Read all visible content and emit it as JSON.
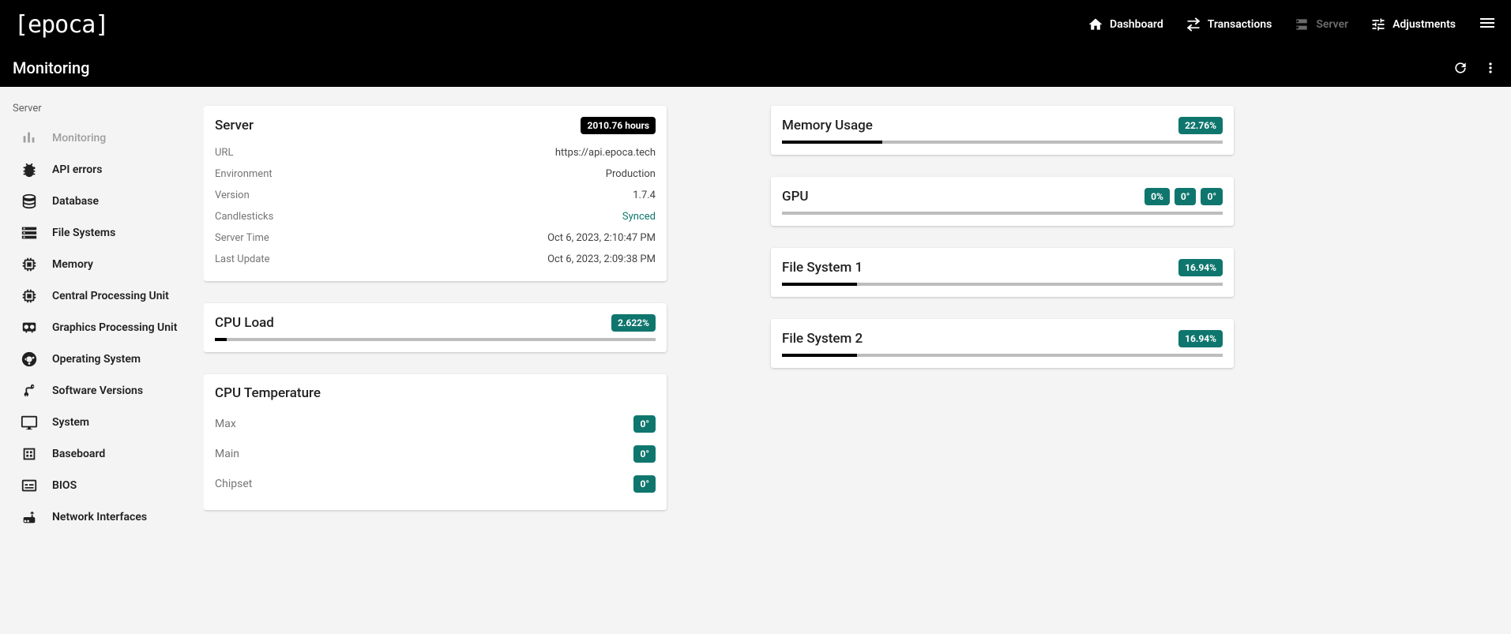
{
  "brand": "[epoca]",
  "topnav": {
    "dashboard": "Dashboard",
    "transactions": "Transactions",
    "server": "Server",
    "adjustments": "Adjustments"
  },
  "page_title": "Monitoring",
  "sidebar": {
    "heading": "Server",
    "items": [
      {
        "label": "Monitoring",
        "icon": "bar-chart-icon",
        "disabled": true
      },
      {
        "label": "API errors",
        "icon": "bug-icon"
      },
      {
        "label": "Database",
        "icon": "database-icon"
      },
      {
        "label": "File Systems",
        "icon": "storage-icon"
      },
      {
        "label": "Memory",
        "icon": "memory-icon"
      },
      {
        "label": "Central Processing Unit",
        "icon": "cpu-icon"
      },
      {
        "label": "Graphics Processing Unit",
        "icon": "gpu-icon"
      },
      {
        "label": "Operating System",
        "icon": "ubuntu-icon"
      },
      {
        "label": "Software Versions",
        "icon": "branch-icon"
      },
      {
        "label": "System",
        "icon": "monitor-icon"
      },
      {
        "label": "Baseboard",
        "icon": "board-icon"
      },
      {
        "label": "BIOS",
        "icon": "bios-icon"
      },
      {
        "label": "Network Interfaces",
        "icon": "router-icon"
      }
    ]
  },
  "server_card": {
    "title": "Server",
    "uptime_badge": "2010.76 hours",
    "rows": {
      "url_k": "URL",
      "url_v": "https://api.epoca.tech",
      "env_k": "Environment",
      "env_v": "Production",
      "ver_k": "Version",
      "ver_v": "1.7.4",
      "cs_k": "Candlesticks",
      "cs_v": "Synced",
      "time_k": "Server Time",
      "time_v": "Oct 6, 2023, 2:10:47 PM",
      "upd_k": "Last Update",
      "upd_v": "Oct 6, 2023, 2:09:38 PM"
    }
  },
  "cpu_load": {
    "title": "CPU Load",
    "badge": "2.622%",
    "percent": 2.622
  },
  "cpu_temp": {
    "title": "CPU Temperature",
    "max_k": "Max",
    "max_v": "0°",
    "main_k": "Main",
    "main_v": "0°",
    "chip_k": "Chipset",
    "chip_v": "0°"
  },
  "memory": {
    "title": "Memory Usage",
    "badge": "22.76%",
    "percent": 22.76
  },
  "gpu": {
    "title": "GPU",
    "b1": "0%",
    "b2": "0°",
    "b3": "0°",
    "percent": 0
  },
  "fs1": {
    "title": "File System 1",
    "badge": "16.94%",
    "percent": 16.94
  },
  "fs2": {
    "title": "File System 2",
    "badge": "16.94%",
    "percent": 16.94
  }
}
